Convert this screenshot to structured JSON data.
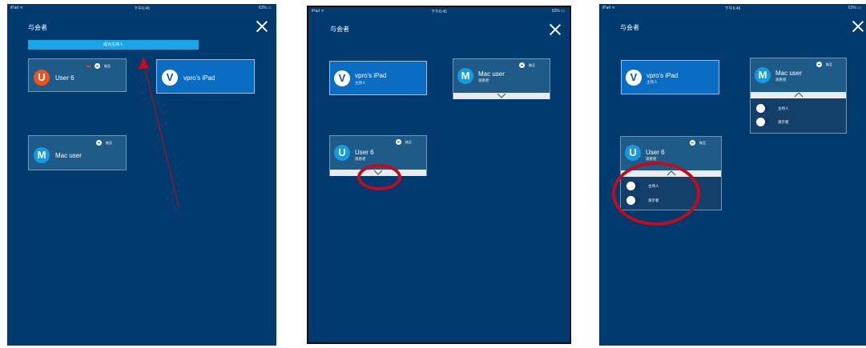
{
  "status": {
    "left": "iPad ᯤ",
    "time_1": "下午6:45",
    "time_2": "下午6:45",
    "time_3": "下午6:46",
    "battery": "63% ▭"
  },
  "dialog": {
    "title": "与会者"
  },
  "dropzone": {
    "label": "成为主持人"
  },
  "participants": {
    "user6": {
      "initial": "U",
      "name": "User 6",
      "role": "观看者"
    },
    "vpro": {
      "initial": "V",
      "name": "vpro's iPad",
      "role": "主持人"
    },
    "mac": {
      "initial": "M",
      "name": "Mac user",
      "role": "观看者"
    }
  },
  "mini_action": {
    "label": "拖至"
  },
  "role_options": {
    "host": "主持人",
    "presenter": "演示者"
  },
  "colors": {
    "panel": "#003a6e",
    "highlight": "#c20b1c",
    "dropzone": "#18a6e7",
    "avatar_u": "#f0521c",
    "avatar_blue": "#179be0"
  },
  "icons": [
    "close-icon",
    "chevron-down-icon",
    "chevron-up-icon",
    "toggle-icon"
  ]
}
